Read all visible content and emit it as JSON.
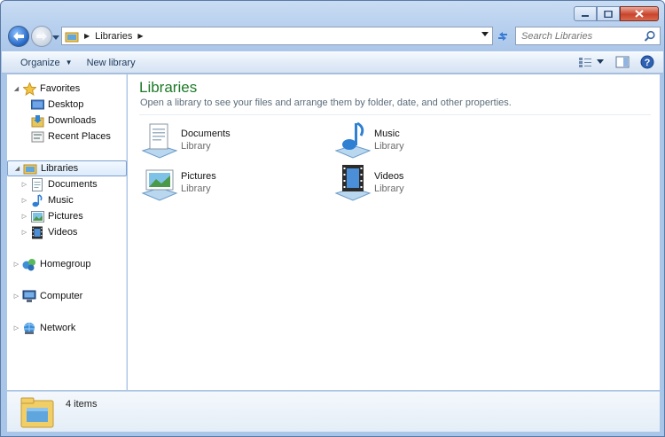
{
  "address": {
    "crumbs": [
      "Libraries"
    ]
  },
  "search": {
    "placeholder": "Search Libraries"
  },
  "toolbar": {
    "organize_label": "Organize",
    "new_library_label": "New library"
  },
  "nav": {
    "favorites": {
      "label": "Favorites",
      "items": [
        "Desktop",
        "Downloads",
        "Recent Places"
      ]
    },
    "libraries": {
      "label": "Libraries",
      "items": [
        "Documents",
        "Music",
        "Pictures",
        "Videos"
      ]
    },
    "homegroup": "Homegroup",
    "computer": "Computer",
    "network": "Network"
  },
  "content": {
    "title": "Libraries",
    "subtitle": "Open a library to see your files and arrange them by folder, date, and other properties.",
    "libraries": [
      {
        "name": "Documents",
        "type": "Library",
        "icon": "documents-library-icon"
      },
      {
        "name": "Music",
        "type": "Library",
        "icon": "music-library-icon"
      },
      {
        "name": "Pictures",
        "type": "Library",
        "icon": "pictures-library-icon"
      },
      {
        "name": "Videos",
        "type": "Library",
        "icon": "videos-library-icon"
      }
    ]
  },
  "details": {
    "item_count": "4 items"
  },
  "colors": {
    "title_green": "#1e7a28",
    "chrome_blue": "#b7d0ee",
    "close_red": "#c9442c"
  }
}
